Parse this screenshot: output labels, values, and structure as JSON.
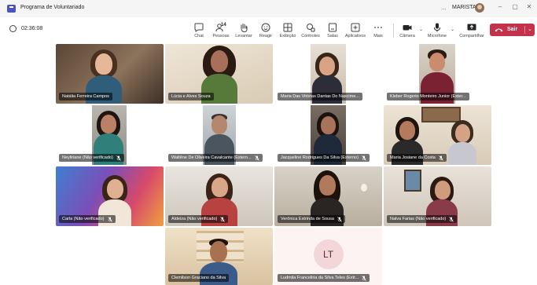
{
  "window": {
    "title": "Programa de Voluntariado",
    "more": "...",
    "user": "MARISTA",
    "minimize": "–",
    "restore": "▢",
    "close": "✕"
  },
  "toolbar": {
    "timer": "02:36:08",
    "participant_count": "14",
    "items": [
      {
        "label": "Chat",
        "icon": "chat-icon"
      },
      {
        "label": "Pessoas",
        "icon": "people-icon"
      },
      {
        "label": "Levantar",
        "icon": "raise-hand-icon"
      },
      {
        "label": "Reagir",
        "icon": "react-icon"
      },
      {
        "label": "Exibição",
        "icon": "view-icon"
      },
      {
        "label": "Controles",
        "icon": "controls-icon"
      },
      {
        "label": "Salas",
        "icon": "rooms-icon"
      },
      {
        "label": "Aplicativos",
        "icon": "apps-icon"
      },
      {
        "label": "Mais",
        "icon": "more-icon"
      },
      {
        "label": "Câmera",
        "icon": "camera-icon"
      },
      {
        "label": "Microfone",
        "icon": "microphone-icon"
      },
      {
        "label": "Compartilhar",
        "icon": "share-icon"
      }
    ],
    "leave": "Sair"
  },
  "participants": [
    {
      "name": "Natália Ferreira Campos",
      "muted": false
    },
    {
      "name": "Lúcia e Alves Souza",
      "muted": false
    },
    {
      "name": "Maria Das Vitórias Dantas Do Nascime...",
      "muted": false
    },
    {
      "name": "Kleber Rogerio Monteiro Junior (Exter...",
      "muted": false
    },
    {
      "name": "Neyliriane (Não verificado)",
      "muted": true
    },
    {
      "name": "Waltêne De Oliveira Cavalcante (Extern...",
      "muted": true
    },
    {
      "name": "Jacqueline Rodrigues Da Silva (Externo)",
      "muted": true
    },
    {
      "name": "Maria Josiane da Costa",
      "muted": true
    },
    {
      "name": "Carla (Não verificado)",
      "muted": true
    },
    {
      "name": "Aldeiza (Não verificado)",
      "muted": true
    },
    {
      "name": "Verônica Estrinda de Sousa",
      "muted": true
    },
    {
      "name": "Nalva Farias (Não verificado)",
      "muted": true
    },
    {
      "name": "Clemilson Graciano da Silva",
      "muted": false
    },
    {
      "name": "Ludmila Franceliria da Silva Teles (Extr...",
      "muted": true,
      "initials": "LT"
    }
  ],
  "colors": {
    "leave_button": "#c4314b",
    "avatar_bg": "#f3d6d8",
    "stage_bg": "#ffffff"
  }
}
